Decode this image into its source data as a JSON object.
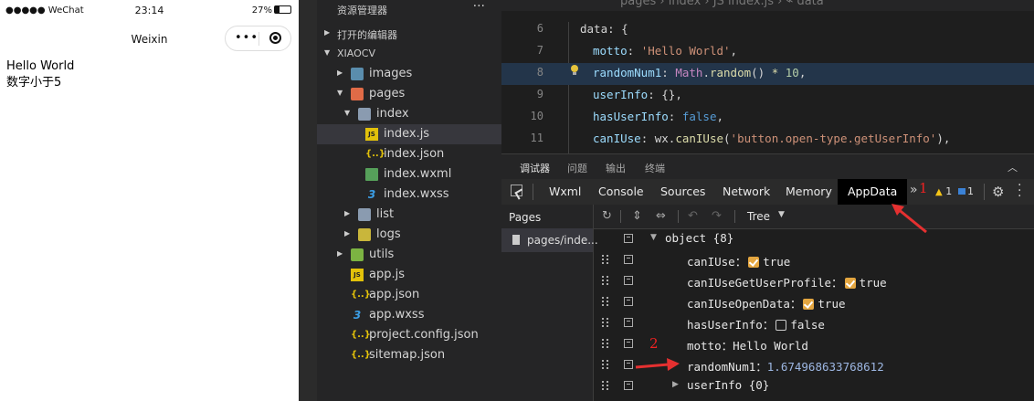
{
  "phone": {
    "status": {
      "carrier": "●●●●● WeChat",
      "time": "23:14",
      "battery": "27%"
    },
    "nav_title": "Weixin",
    "capsule": {
      "more": "•••"
    },
    "content": {
      "line1": "Hello World",
      "line2": "数字小于5"
    }
  },
  "explorer": {
    "title": "资源管理器",
    "more": "···",
    "open_editors": "打开的编辑器",
    "project": "XIAOCV",
    "tree": [
      {
        "name": "images",
        "type": "folder"
      },
      {
        "name": "pages",
        "type": "folder"
      },
      {
        "name": "index",
        "type": "folder"
      },
      {
        "name": "index.js",
        "type": "js"
      },
      {
        "name": "index.json",
        "type": "json"
      },
      {
        "name": "index.wxml",
        "type": "wxml"
      },
      {
        "name": "index.wxss",
        "type": "wxss"
      },
      {
        "name": "list",
        "type": "folder"
      },
      {
        "name": "logs",
        "type": "folder"
      },
      {
        "name": "utils",
        "type": "folder"
      },
      {
        "name": "app.js",
        "type": "js"
      },
      {
        "name": "app.json",
        "type": "json"
      },
      {
        "name": "app.wxss",
        "type": "wxss"
      },
      {
        "name": "project.config.json",
        "type": "json"
      },
      {
        "name": "sitemap.json",
        "type": "json"
      }
    ],
    "selected": "index.js"
  },
  "editor": {
    "breadcrumb": "pages › index › JS index.js › ⌁ data",
    "lines": [
      {
        "num": "6",
        "parts": [
          [
            "",
            "data: {"
          ]
        ]
      },
      {
        "num": "7",
        "parts": [
          [
            "k-prop",
            "motto"
          ],
          [
            "",
            ": "
          ],
          [
            "k-str",
            "'Hello World'"
          ],
          [
            "",
            ","
          ]
        ]
      },
      {
        "num": "8",
        "parts": [
          [
            "k-prop",
            "randomNum1"
          ],
          [
            "",
            ": "
          ],
          [
            "k-obj",
            "Math"
          ],
          [
            "",
            "."
          ],
          [
            "k-fn",
            "random"
          ],
          [
            "",
            "() "
          ],
          [
            "k-fn",
            "*"
          ],
          [
            "",
            " "
          ],
          [
            "k-num",
            "10"
          ],
          [
            "",
            ","
          ]
        ]
      },
      {
        "num": "9",
        "parts": [
          [
            "k-prop",
            "userInfo"
          ],
          [
            "",
            ": {},"
          ]
        ]
      },
      {
        "num": "10",
        "parts": [
          [
            "k-prop",
            "hasUserInfo"
          ],
          [
            "",
            ": "
          ],
          [
            "k-kw",
            "false"
          ],
          [
            "",
            ","
          ]
        ]
      },
      {
        "num": "11",
        "parts": [
          [
            "k-prop",
            "canIUse"
          ],
          [
            "",
            ": wx."
          ],
          [
            "k-fn",
            "canIUse"
          ],
          [
            "",
            "("
          ],
          [
            "k-str",
            "'button.open-type.getUserInfo'"
          ],
          [
            "",
            "),"
          ]
        ]
      }
    ]
  },
  "panel": {
    "tabs": [
      "调试器",
      "问题",
      "输出",
      "终端"
    ],
    "collapse": "︿",
    "devtools_tabs": [
      "Wxml",
      "Console",
      "Sources",
      "Network",
      "Memory",
      "AppData"
    ],
    "active_devtool": "AppData",
    "more": "»",
    "warnings": "1",
    "messages": "1",
    "pages_header": "Pages",
    "page_item": "pages/inde...",
    "toolbar": {
      "view_mode": "Tree"
    },
    "appdata": {
      "root": "object {8}",
      "rows": [
        {
          "key": "canIUse",
          "kind": "bool",
          "value": "true",
          "checked": true
        },
        {
          "key": "canIUseGetUserProfile",
          "kind": "bool",
          "value": "true",
          "checked": true
        },
        {
          "key": "canIUseOpenData",
          "kind": "bool",
          "value": "true",
          "checked": true
        },
        {
          "key": "hasUserInfo",
          "kind": "bool",
          "value": "false",
          "checked": false
        },
        {
          "key": "motto",
          "kind": "str",
          "value": "Hello World"
        },
        {
          "key": "randomNum1",
          "kind": "num",
          "value": "1.674968633768612"
        },
        {
          "key": "userInfo",
          "kind": "obj",
          "value": "{0}"
        }
      ]
    }
  },
  "annotations": {
    "one": "1",
    "two": "2",
    "color": "#e53030"
  }
}
